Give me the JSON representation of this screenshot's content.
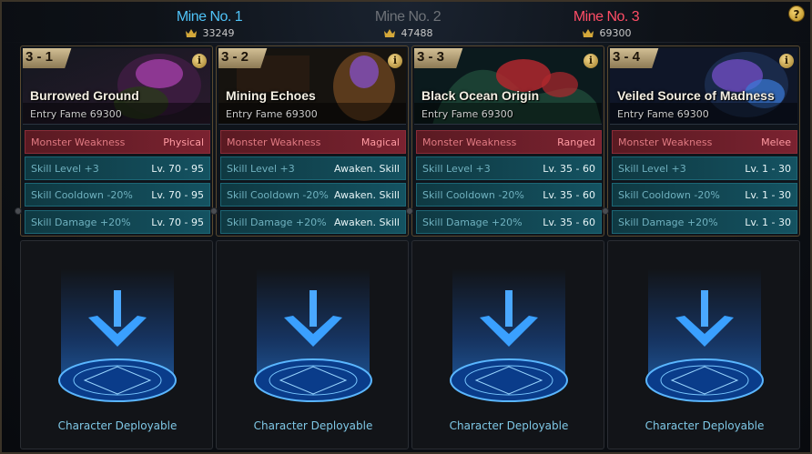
{
  "mines": [
    {
      "title": "Mine No. 1",
      "fame": "33249"
    },
    {
      "title": "Mine No. 2",
      "fame": "47488"
    },
    {
      "title": "Mine No. 3",
      "fame": "69300"
    }
  ],
  "help_label": "?",
  "info_label": "i",
  "cards": [
    {
      "stage": "3 - 1",
      "title": "Burrowed Ground",
      "fame": "Entry Fame 69300",
      "weakness_label": "Monster Weakness",
      "weakness_value": "Physical",
      "rows": [
        {
          "label": "Skill Level +3",
          "value": "Lv. 70 - 95"
        },
        {
          "label": "Skill Cooldown -20%",
          "value": "Lv. 70 - 95"
        },
        {
          "label": "Skill Damage +20%",
          "value": "Lv. 70 - 95"
        }
      ],
      "slot_label": "Character Deployable",
      "art_colors": [
        "#3a1c3e",
        "#a33fa8",
        "#2a3a1c"
      ]
    },
    {
      "stage": "3 - 2",
      "title": "Mining Echoes",
      "fame": "Entry Fame 69300",
      "weakness_label": "Monster Weakness",
      "weakness_value": "Magical",
      "rows": [
        {
          "label": "Skill Level +3",
          "value": "Awaken. Skill"
        },
        {
          "label": "Skill Cooldown -20%",
          "value": "Awaken. Skill"
        },
        {
          "label": "Skill Damage +20%",
          "value": "Awaken. Skill"
        }
      ],
      "slot_label": "Character Deployable",
      "art_colors": [
        "#2a1d12",
        "#7a4aa0",
        "#5a3a1c"
      ]
    },
    {
      "stage": "3 - 3",
      "title": "Black Ocean Origin",
      "fame": "Entry Fame 69300",
      "weakness_label": "Monster Weakness",
      "weakness_value": "Ranged",
      "rows": [
        {
          "label": "Skill Level +3",
          "value": "Lv. 35 - 60"
        },
        {
          "label": "Skill Cooldown -20%",
          "value": "Lv. 35 - 60"
        },
        {
          "label": "Skill Damage +20%",
          "value": "Lv. 35 - 60"
        }
      ],
      "slot_label": "Character Deployable",
      "art_colors": [
        "#0d2a2e",
        "#b0282e",
        "#1f4a3a"
      ]
    },
    {
      "stage": "3 - 4",
      "title": "Veiled Source of Madness",
      "fame": "Entry Fame 69300",
      "weakness_label": "Monster Weakness",
      "weakness_value": "Melee",
      "rows": [
        {
          "label": "Skill Level +3",
          "value": "Lv. 1 - 30"
        },
        {
          "label": "Skill Cooldown -20%",
          "value": "Lv. 1 - 30"
        },
        {
          "label": "Skill Damage +20%",
          "value": "Lv. 1 - 30"
        }
      ],
      "slot_label": "Character Deployable",
      "art_colors": [
        "#1a2a4a",
        "#6a4ab8",
        "#3a7ad8"
      ]
    }
  ]
}
